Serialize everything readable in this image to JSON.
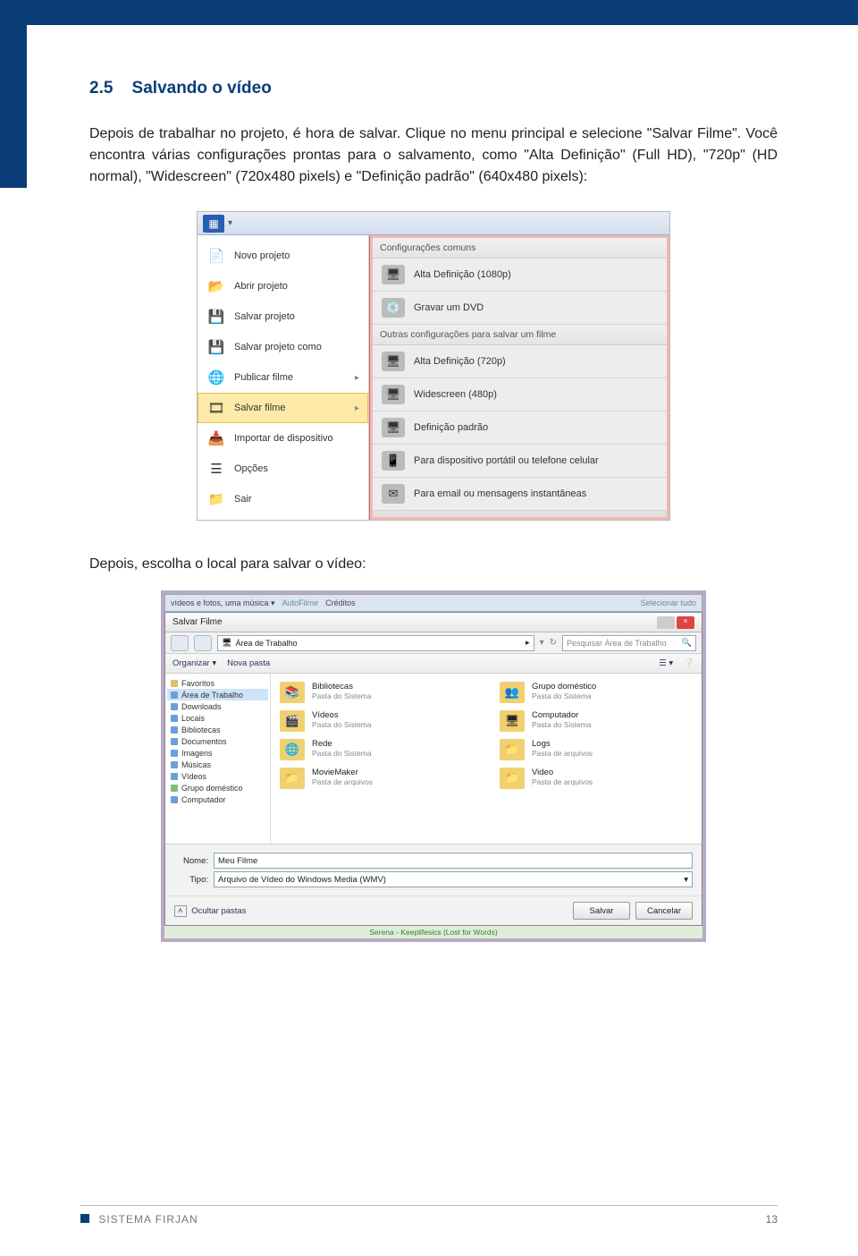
{
  "section": {
    "number": "2.5",
    "title": "Salvando o vídeo"
  },
  "para1": "Depois de trabalhar no projeto, é hora de salvar. Clique no menu principal e selecione \"Salvar Filme\". Você encontra várias configurações prontas para o salvamento, como \"Alta Definição\" (Full HD), \"720p\" (HD normal), \"Widescreen\" (720x480 pixels) e \"Definição padrão\" (640x480 pixels):",
  "mm": {
    "left_items": [
      {
        "label": "Novo projeto",
        "icon": "📄"
      },
      {
        "label": "Abrir projeto",
        "icon": "📂"
      },
      {
        "label": "Salvar projeto",
        "icon": "💾"
      },
      {
        "label": "Salvar projeto como",
        "icon": "💾"
      },
      {
        "label": "Publicar filme",
        "icon": "🌐",
        "arrow": true
      },
      {
        "label": "Salvar filme",
        "icon": "🎞",
        "arrow": true,
        "hover": true
      },
      {
        "label": "Importar de dispositivo",
        "icon": "📥"
      },
      {
        "label": "Opções",
        "icon": "☰"
      },
      {
        "label": "Sair",
        "icon": "📁"
      }
    ],
    "heads": [
      "Configurações comuns",
      "Outras configurações para salvar um filme"
    ],
    "opts1": [
      {
        "label": "Alta Definição (1080p)",
        "icon": "🖥"
      },
      {
        "label": "Gravar um DVD",
        "icon": "💿"
      }
    ],
    "opts2": [
      {
        "label": "Alta Definição (720p)",
        "icon": "🖥"
      },
      {
        "label": "Widescreen (480p)",
        "icon": "🖥"
      },
      {
        "label": "Definição padrão",
        "icon": "🖥"
      },
      {
        "label": "Para dispositivo portátil ou telefone celular",
        "icon": "📱"
      },
      {
        "label": "Para email ou mensagens instantâneas",
        "icon": "✉"
      }
    ]
  },
  "para2": "Depois, escolha o local para salvar o vídeo:",
  "sd": {
    "title": "Salvar Filme",
    "path_label": "Área de Trabalho",
    "search_placeholder": "Pesquisar Área de Trabalho",
    "toolbar": {
      "organize": "Organizar ▾",
      "newfolder": "Nova pasta"
    },
    "tree": [
      {
        "label": "Favoritos",
        "cls": ""
      },
      {
        "label": "Área de Trabalho",
        "cls": "sel b"
      },
      {
        "label": "Downloads",
        "cls": "b"
      },
      {
        "label": "Locais",
        "cls": "b"
      },
      {
        "label": "Bibliotecas",
        "cls": "b"
      },
      {
        "label": "Documentos",
        "cls": "b"
      },
      {
        "label": "Imagens",
        "cls": "b"
      },
      {
        "label": "Músicas",
        "cls": "b"
      },
      {
        "label": "Vídeos",
        "cls": "b"
      },
      {
        "label": "Grupo doméstico",
        "cls": "g"
      },
      {
        "label": "Computador",
        "cls": "b"
      }
    ],
    "files": [
      {
        "name": "Bibliotecas",
        "sub": "Pasta do Sistema",
        "icon": "📚"
      },
      {
        "name": "Grupo doméstico",
        "sub": "Pasta do Sistema",
        "icon": "👥"
      },
      {
        "name": "Vídeos",
        "sub": "Pasta do Sistema",
        "icon": "🎬"
      },
      {
        "name": "Computador",
        "sub": "Pasta do Sistema",
        "icon": "🖥"
      },
      {
        "name": "Rede",
        "sub": "Pasta do Sistema",
        "icon": "🌐"
      },
      {
        "name": "Logs",
        "sub": "Pasta de arquivos",
        "icon": "📁"
      },
      {
        "name": "MovieMaker",
        "sub": "Pasta de arquivos",
        "icon": "📁"
      },
      {
        "name": "Video",
        "sub": "Pasta de arquivos",
        "icon": "📁"
      }
    ],
    "name_label": "Nome:",
    "name_value": "Meu Filme",
    "type_label": "Tipo:",
    "type_value": "Arquivo de Vídeo do Windows Media (WMV)",
    "hide": "Ocultar pastas",
    "save": "Salvar",
    "cancel": "Cancelar",
    "greenbar": "Serena - Keeplifesics (Lost for Words)"
  },
  "footer": {
    "brand": "SISTEMA FIRJAN",
    "page": "13"
  }
}
